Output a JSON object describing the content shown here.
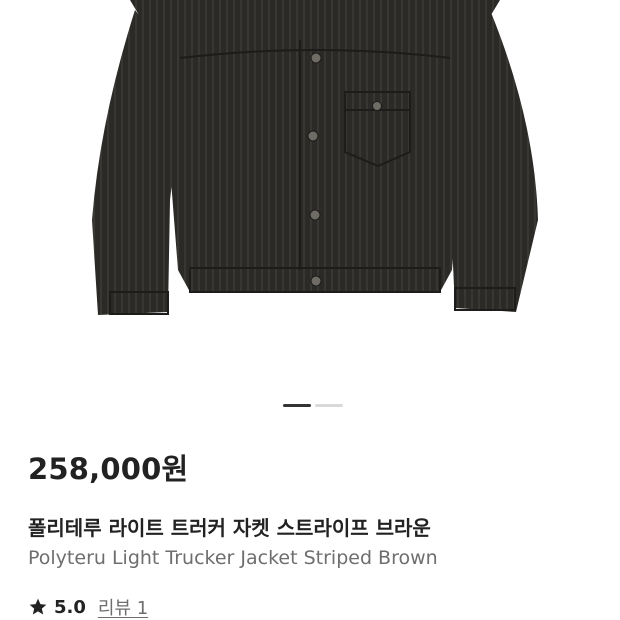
{
  "product": {
    "price": "258,000원",
    "title_ko": "폴리테루 라이트 트러커 자켓 스트라이프 브라운",
    "title_en": "Polyteru Light Trucker Jacket Striped Brown",
    "image_icon": "striped-trucker-jacket-photo"
  },
  "carousel": {
    "total": 2,
    "active_index": 0
  },
  "rating": {
    "icon": "star-icon",
    "score": "5.0",
    "review_label": "리뷰 1"
  },
  "colors": {
    "jacket": "#2b2a27",
    "stripe": "#46443f",
    "indicator_active": "#333333",
    "indicator_inactive": "#d9d9d9",
    "text_primary": "#222222",
    "text_secondary": "#6e6e6e"
  }
}
